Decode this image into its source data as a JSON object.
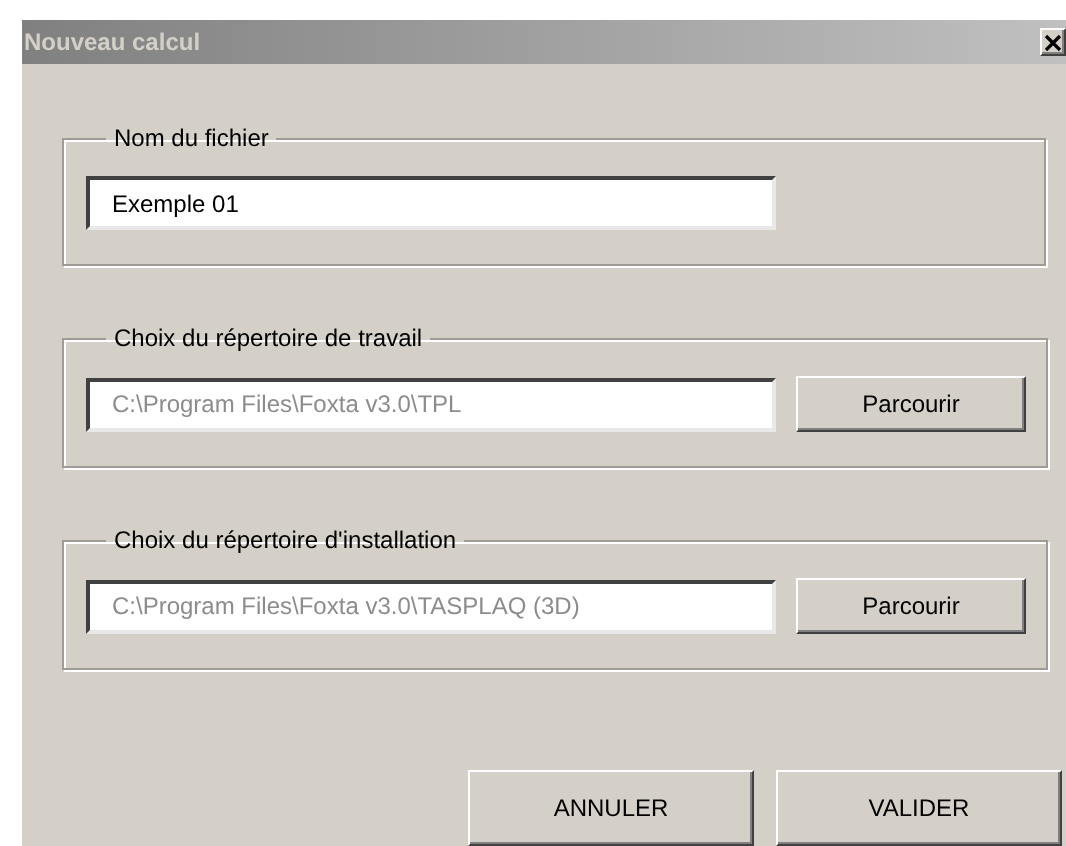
{
  "window": {
    "title": "Nouveau calcul"
  },
  "groups": [
    {
      "label": "Nom du fichier",
      "field": {
        "value": "Exemple 01",
        "disabled": false
      }
    },
    {
      "label": "Choix du répertoire de travail",
      "field": {
        "value": "C:\\Program Files\\Foxta v3.0\\TPL",
        "disabled": true
      },
      "button": "Parcourir"
    },
    {
      "label": "Choix du répertoire d'installation",
      "field": {
        "value": "C:\\Program Files\\Foxta v3.0\\TASPLAQ (3D)",
        "disabled": true
      },
      "button": "Parcourir"
    }
  ],
  "buttons": [
    "ANNULER",
    "VALIDER"
  ]
}
